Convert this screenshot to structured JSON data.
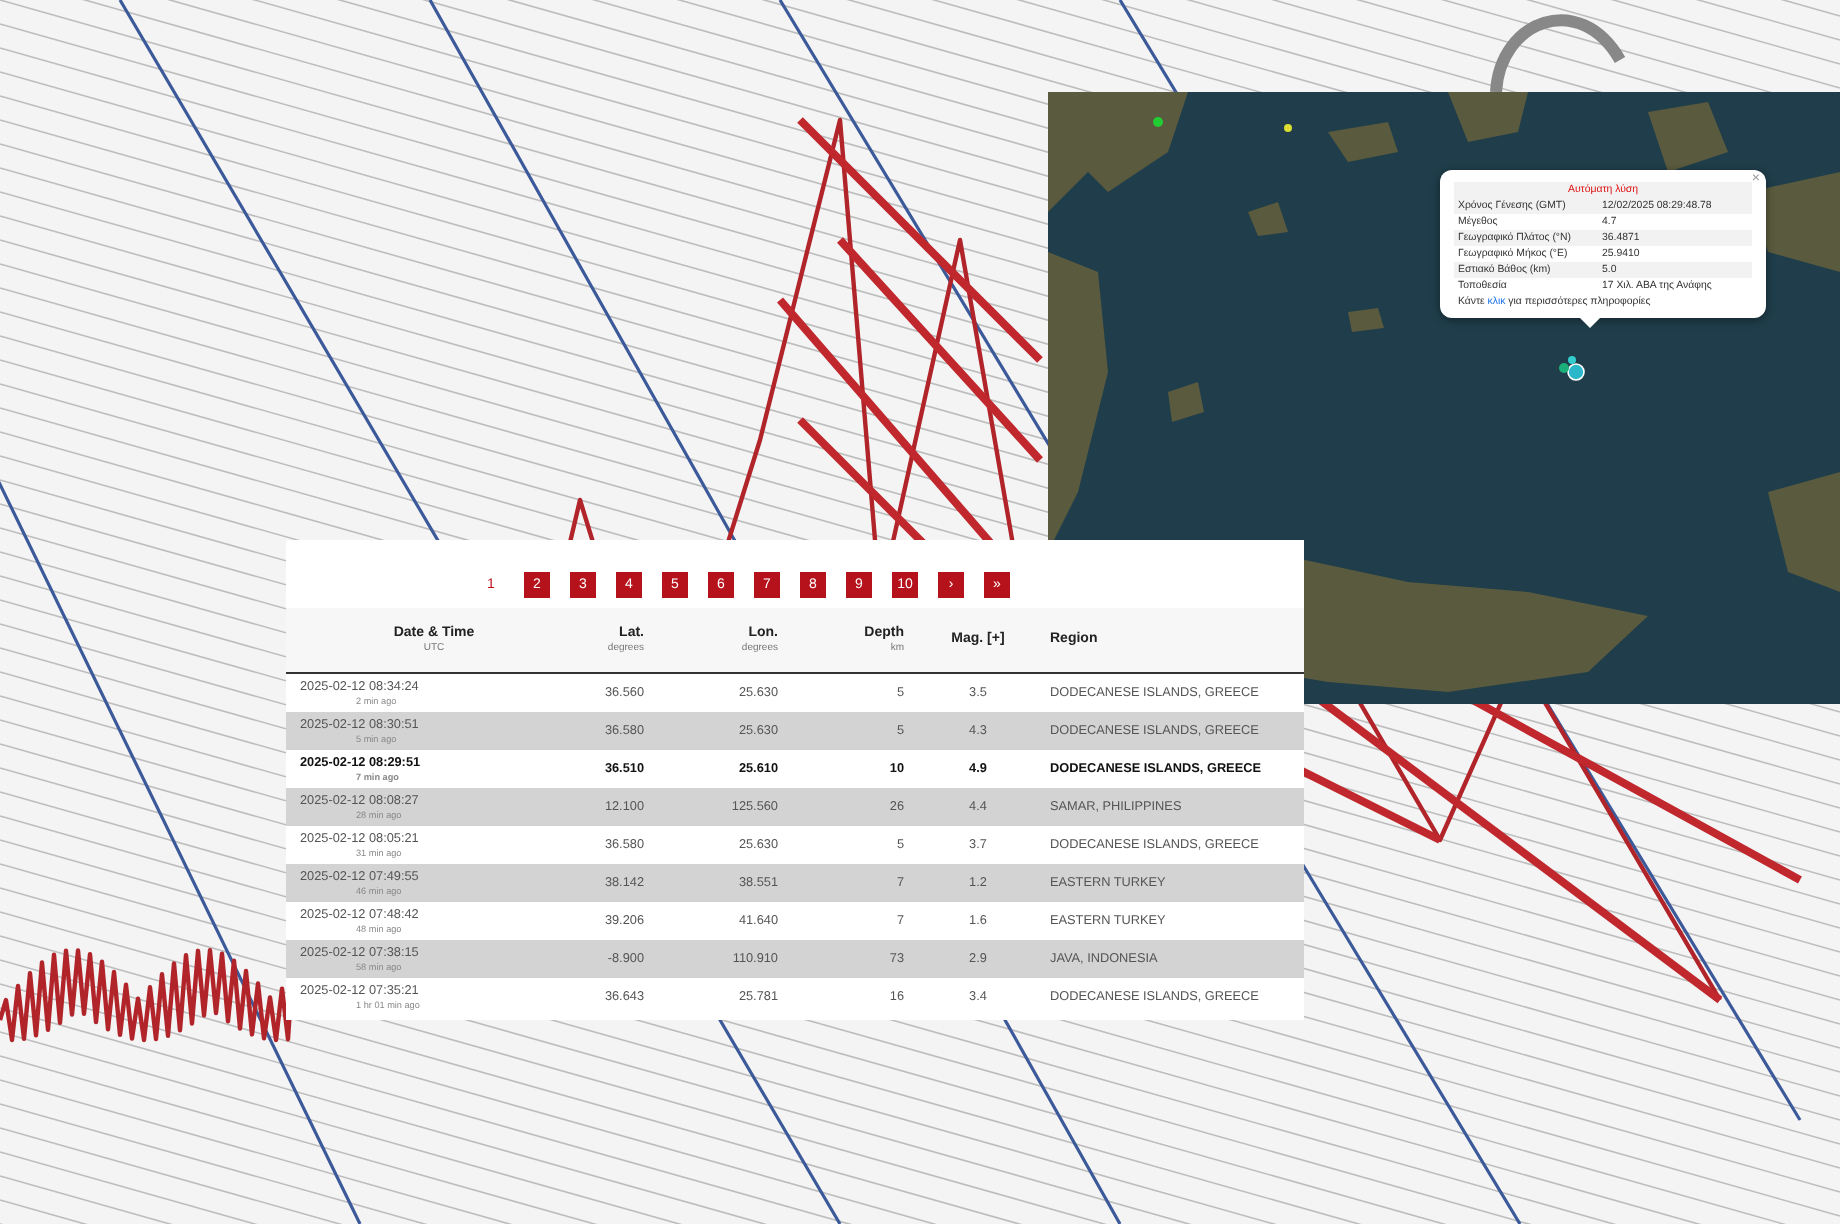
{
  "pagination": {
    "pages": [
      {
        "label": "1",
        "selected": true
      },
      {
        "label": "2",
        "selected": false
      },
      {
        "label": "3",
        "selected": false
      },
      {
        "label": "4",
        "selected": false
      },
      {
        "label": "5",
        "selected": false
      },
      {
        "label": "6",
        "selected": false
      },
      {
        "label": "7",
        "selected": false
      },
      {
        "label": "8",
        "selected": false
      },
      {
        "label": "9",
        "selected": false
      },
      {
        "label": "10",
        "selected": false
      }
    ],
    "next": "›",
    "last": "»"
  },
  "table": {
    "columns": [
      {
        "title": "Date & Time",
        "unit": "UTC"
      },
      {
        "title": "Lat.",
        "unit": "degrees"
      },
      {
        "title": "Lon.",
        "unit": "degrees"
      },
      {
        "title": "Depth",
        "unit": "km"
      },
      {
        "title": "Mag. [+]"
      },
      {
        "title": "Region"
      }
    ],
    "rows": [
      {
        "date": "2025-02-12 08:34:24",
        "ago": "2 min ago",
        "lat": "36.560",
        "lon": "25.630",
        "depth": "5",
        "mag": "3.5",
        "region": "DODECANESE ISLANDS, GREECE",
        "emphasized": false
      },
      {
        "date": "2025-02-12 08:30:51",
        "ago": "5 min ago",
        "lat": "36.580",
        "lon": "25.630",
        "depth": "5",
        "mag": "4.3",
        "region": "DODECANESE ISLANDS, GREECE",
        "emphasized": false
      },
      {
        "date": "2025-02-12 08:29:51",
        "ago": "7 min ago",
        "lat": "36.510",
        "lon": "25.610",
        "depth": "10",
        "mag": "4.9",
        "region": "DODECANESE ISLANDS, GREECE",
        "emphasized": true
      },
      {
        "date": "2025-02-12 08:08:27",
        "ago": "28 min ago",
        "lat": "12.100",
        "lon": "125.560",
        "depth": "26",
        "mag": "4.4",
        "region": "SAMAR, PHILIPPINES",
        "emphasized": false
      },
      {
        "date": "2025-02-12 08:05:21",
        "ago": "31 min ago",
        "lat": "36.580",
        "lon": "25.630",
        "depth": "5",
        "mag": "3.7",
        "region": "DODECANESE ISLANDS, GREECE",
        "emphasized": false
      },
      {
        "date": "2025-02-12 07:49:55",
        "ago": "46 min ago",
        "lat": "38.142",
        "lon": "38.551",
        "depth": "7",
        "mag": "1.2",
        "region": "EASTERN TURKEY",
        "emphasized": false
      },
      {
        "date": "2025-02-12 07:48:42",
        "ago": "48 min ago",
        "lat": "39.206",
        "lon": "41.640",
        "depth": "7",
        "mag": "1.6",
        "region": "EASTERN TURKEY",
        "emphasized": false
      },
      {
        "date": "2025-02-12 07:38:15",
        "ago": "58 min ago",
        "lat": "-8.900",
        "lon": "110.910",
        "depth": "73",
        "mag": "2.9",
        "region": "JAVA, INDONESIA",
        "emphasized": false
      },
      {
        "date": "2025-02-12 07:35:21",
        "ago": "1 hr 01 min ago",
        "lat": "36.643",
        "lon": "25.781",
        "depth": "16",
        "mag": "3.4",
        "region": "DODECANESE ISLANDS, GREECE",
        "emphasized": false
      }
    ]
  },
  "map": {
    "popup": {
      "close": "×",
      "title": "Αυτόματη λύση",
      "rows": [
        {
          "label": "Χρόνος Γένεσης (GMT)",
          "value": "12/02/2025 08:29:48.78"
        },
        {
          "label": "Μέγεθος",
          "value": "4.7"
        },
        {
          "label": "Γεωγραφικό Πλάτος (°N)",
          "value": "36.4871"
        },
        {
          "label": "Γεωγραφικό Μήκος (°E)",
          "value": "25.9410"
        },
        {
          "label": "Εστιακό Βάθος (km)",
          "value": "5.0"
        },
        {
          "label": "Τοποθεσία",
          "value": "17 Χιλ. ΑΒΑ της Ανάφης"
        }
      ],
      "footer": {
        "before": "Κάντε",
        "link": "κλικ",
        "after": "για περισσότερες πληροφορίες"
      }
    }
  }
}
